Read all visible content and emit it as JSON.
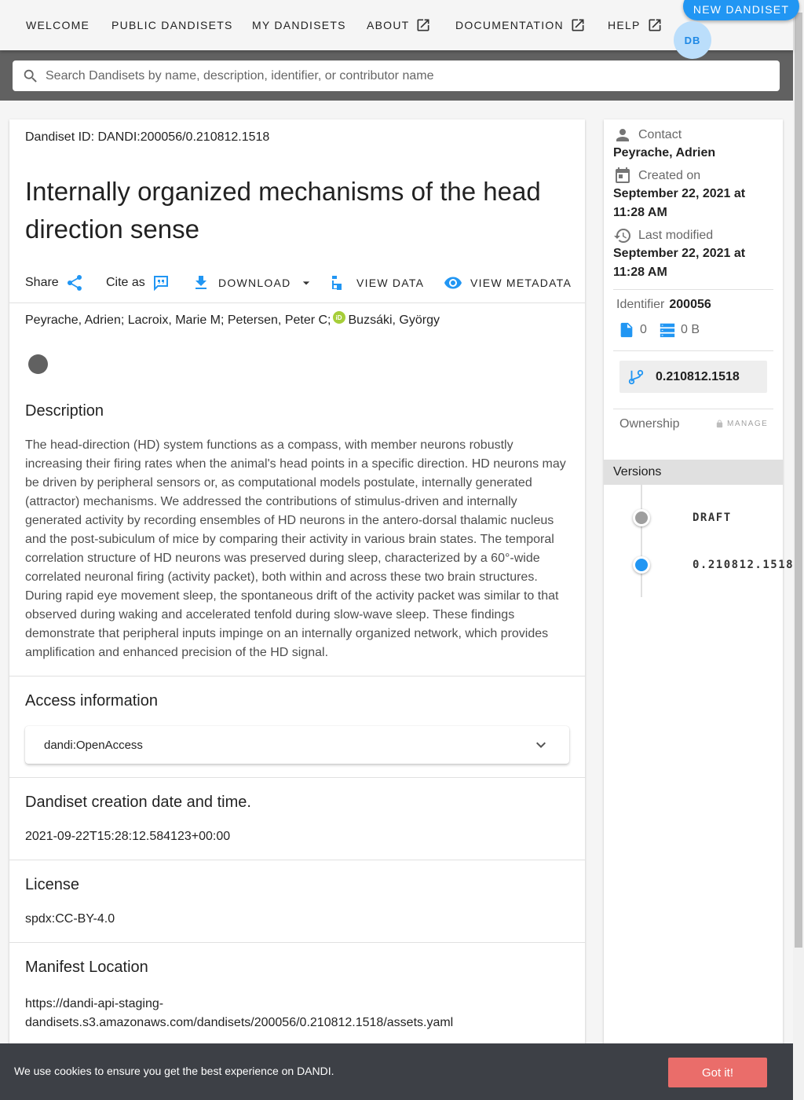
{
  "nav": {
    "items": [
      {
        "label": "WELCOME"
      },
      {
        "label": "PUBLIC DANDISETS"
      },
      {
        "label": "MY DANDISETS"
      },
      {
        "label": "ABOUT"
      },
      {
        "label": "DOCUMENTATION"
      },
      {
        "label": "HELP"
      }
    ],
    "new_dandiset": "NEW DANDISET",
    "avatar_initials": "DB"
  },
  "search": {
    "placeholder": "Search Dandisets by name, description, identifier, or contributor name"
  },
  "dandiset": {
    "id_line": "Dandiset ID: DANDI:200056/0.210812.1518",
    "title": "Internally organized mechanisms of the head direction sense",
    "actions": {
      "share": "Share",
      "cite": "Cite as",
      "download": "DOWNLOAD",
      "view_data": "VIEW DATA",
      "view_metadata": "VIEW METADATA"
    },
    "authors_part1": "Peyrache, Adrien; Lacroix, Marie M; Petersen, Peter C;",
    "authors_part2": "Buzsáki, György",
    "description_heading": "Description",
    "description": "The head-direction (HD) system functions as a compass, with member neurons robustly increasing their firing rates when the animal's head points in a specific direction. HD neurons may be driven by peripheral sensors or, as computational models postulate, internally generated (attractor) mechanisms. We addressed the contributions of stimulus-driven and internally generated activity by recording ensembles of HD neurons in the antero-dorsal thalamic nucleus and the post-subiculum of mice by comparing their activity in various brain states. The temporal correlation structure of HD neurons was preserved during sleep, characterized by a 60°-wide correlated neuronal firing (activity packet), both within and across these two brain structures. During rapid eye movement sleep, the spontaneous drift of the activity packet was similar to that observed during waking and accelerated tenfold during slow-wave sleep. These findings demonstrate that peripheral inputs impinge on an internally organized network, which provides amplification and enhanced precision of the HD signal.",
    "access_heading": "Access information",
    "access_value": "dandi:OpenAccess",
    "creation_heading": "Dandiset creation date and time.",
    "creation_value": "2021-09-22T15:28:12.584123+00:00",
    "license_heading": "License",
    "license_value": "spdx:CC-BY-4.0",
    "manifest_heading": "Manifest Location",
    "manifest_line1": "https://dandi-api-staging-",
    "manifest_line2": "dandisets.s3.amazonaws.com/dandisets/200056/0.210812.1518/assets.yaml"
  },
  "sidebar": {
    "contact_label": "Contact",
    "contact_value": "Peyrache, Adrien",
    "created_label": "Created on",
    "created_value": "September 22, 2021 at 11:28 AM",
    "modified_label": "Last modified",
    "modified_value": "September 22, 2021 at 11:28 AM",
    "identifier_label": "Identifier",
    "identifier_value": "200056",
    "file_count": "0",
    "size": "0 B",
    "version": "0.210812.1518",
    "ownership_label": "Ownership",
    "manage_label": "MANAGE",
    "versions_heading": "Versions",
    "versions": [
      {
        "label": "DRAFT",
        "color": "#9e9e9e"
      },
      {
        "label": "0.210812.1518",
        "color": "#2196f3"
      }
    ]
  },
  "cookie": {
    "text": "We use cookies to ensure you get the best experience on DANDI.",
    "button": "Got it!"
  },
  "colors": {
    "accent": "#2196f3",
    "search_band": "#616161",
    "cookie_bg": "#3d4046",
    "cookie_button": "#ea6d6a"
  }
}
